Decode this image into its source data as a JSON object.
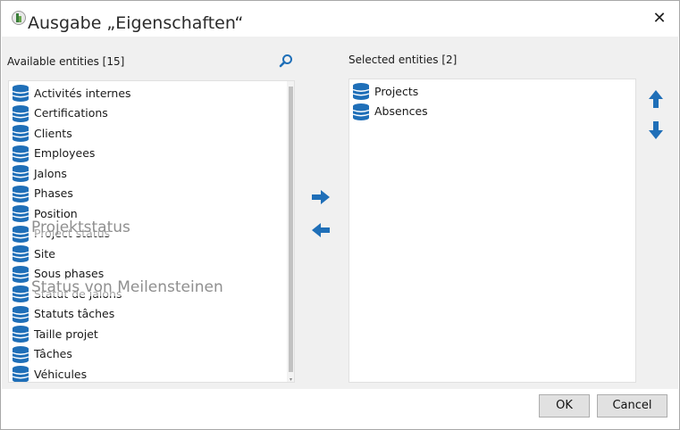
{
  "window": {
    "title": "Ausgabe „Eigenschaften“",
    "close_label": "✕"
  },
  "available": {
    "header": "Available entities [15]",
    "items": [
      {
        "label": "Activités internes"
      },
      {
        "label": "Certifications"
      },
      {
        "label": "Clients"
      },
      {
        "label": "Employees"
      },
      {
        "label": "Jalons"
      },
      {
        "label": "Phases"
      },
      {
        "label": "Position"
      },
      {
        "label": "Project status",
        "overlay": "Projektstatus"
      },
      {
        "label": "Site"
      },
      {
        "label": "Sous phases"
      },
      {
        "label": "Statut de jalons",
        "overlay": "Status von Meilensteinen"
      },
      {
        "label": "Statuts tâches"
      },
      {
        "label": "Taille projet"
      },
      {
        "label": "Tâches"
      },
      {
        "label": "Véhicules"
      }
    ]
  },
  "selected": {
    "header": "Selected entities [2]",
    "items": [
      {
        "label": "Projects"
      },
      {
        "label": "Absences"
      }
    ]
  },
  "footer": {
    "ok_label": "OK",
    "cancel_label": "Cancel"
  },
  "icons": {
    "entity": "database-icon",
    "search": "search-icon",
    "move_right": "arrow-right-icon",
    "move_left": "arrow-left-icon",
    "move_up": "arrow-up-icon",
    "move_down": "arrow-down-icon"
  },
  "colors": {
    "accent": "#1f6fb8",
    "panel": "#f0f0f0"
  }
}
